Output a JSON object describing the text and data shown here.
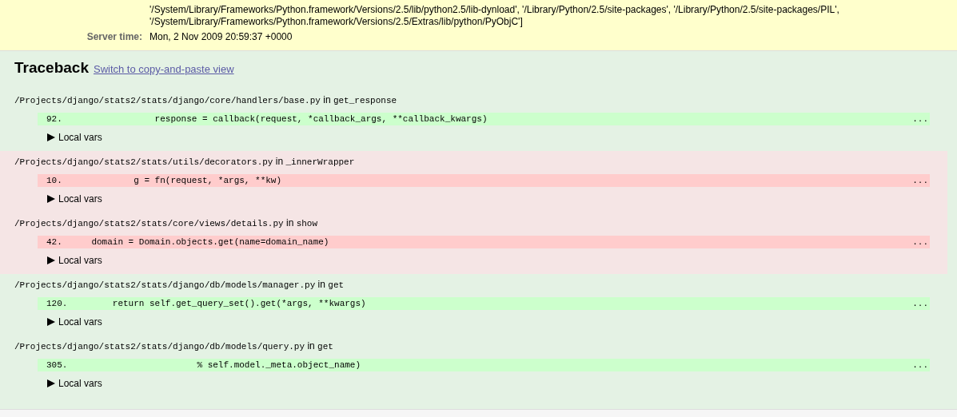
{
  "meta": {
    "path_lines": [
      "'/System/Library/Frameworks/Python.framework/Versions/2.5/lib/python2.5/lib-dynload', '/Library/Python/2.5/site-packages', '/Library/Python/2.5/site-packages/PIL',",
      "'/System/Library/Frameworks/Python.framework/Versions/2.5/Extras/lib/python/PyObjC']"
    ],
    "rows": [
      {
        "label": "Server time:",
        "value": "Mon, 2 Nov 2009 20:59:37 +0000"
      }
    ]
  },
  "traceback": {
    "title": "Traceback",
    "link": "Switch to copy-and-paste view",
    "frames": [
      {
        "kind": "django",
        "file": "/Projects/django/stats2/stats/django/core/handlers/base.py",
        "in": "in",
        "function": "get_response",
        "line_number": "92.",
        "code": "                response = callback(request, *callback_args, **callback_kwargs)",
        "more": "...",
        "toggle": "Local vars"
      },
      {
        "kind": "user",
        "file": "/Projects/django/stats2/stats/utils/decorators.py",
        "in": "in",
        "function": "_innerWrapper",
        "line_number": "10.",
        "code": "            g = fn(request, *args, **kw)",
        "more": "...",
        "toggle": "Local vars"
      },
      {
        "kind": "user",
        "file": "/Projects/django/stats2/stats/core/views/details.py",
        "in": "in",
        "function": "show",
        "line_number": "42.",
        "code": "    domain = Domain.objects.get(name=domain_name)",
        "more": "...",
        "toggle": "Local vars"
      },
      {
        "kind": "django",
        "file": "/Projects/django/stats2/stats/django/db/models/manager.py",
        "in": "in",
        "function": "get",
        "line_number": "120.",
        "code": "        return self.get_query_set().get(*args, **kwargs)",
        "more": "...",
        "toggle": "Local vars"
      },
      {
        "kind": "django",
        "file": "/Projects/django/stats2/stats/django/db/models/query.py",
        "in": "in",
        "function": "get",
        "line_number": "305.",
        "code": "                        % self.model._meta.object_name)",
        "more": "...",
        "toggle": "Local vars"
      }
    ]
  }
}
